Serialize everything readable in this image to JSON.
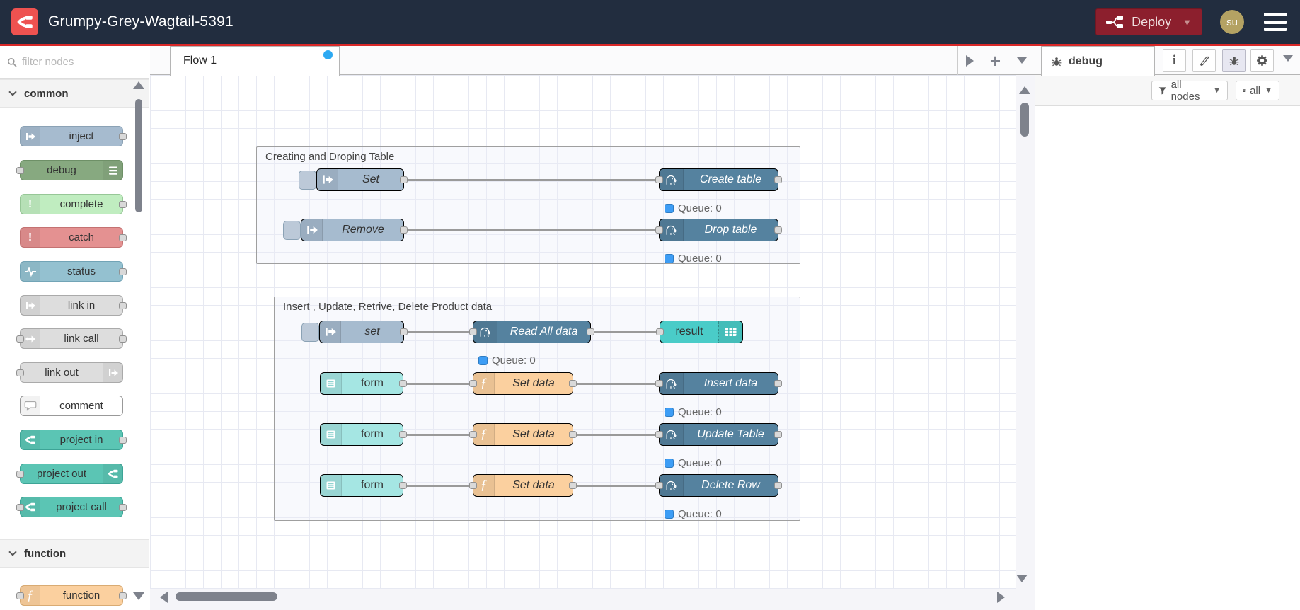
{
  "colors": {
    "header_bg": "#222d3f",
    "header_accent_red": "#d92828",
    "logo_red": "#ee5250",
    "deploy_bg": "#8c1f2d",
    "avatar_bg": "#b4a263",
    "status_dot_blue": "#3d9df5",
    "tab_dirty_dot_blue": "#2da9f2",
    "node_inject": "#a6bbcf",
    "node_debug": "#87a980",
    "node_complete": "#c0edc0",
    "node_catch": "#e49191",
    "node_status": "#94c1d0",
    "node_link": "#dddddd",
    "node_comment": "#ffffff",
    "node_project": "#5bc5b4",
    "node_function": "#fbd09f",
    "node_postgres": "#55829f",
    "node_form": "#a5e6e3",
    "node_result": "#4accc8"
  },
  "header": {
    "title": "Grumpy-Grey-Wagtail-5391",
    "deploy_label": "Deploy",
    "avatar_initials": "su"
  },
  "palette": {
    "search_placeholder": "filter nodes",
    "categories": [
      {
        "label": "common",
        "nodes": [
          {
            "label": "inject"
          },
          {
            "label": "debug"
          },
          {
            "label": "complete"
          },
          {
            "label": "catch"
          },
          {
            "label": "status"
          },
          {
            "label": "link in"
          },
          {
            "label": "link call"
          },
          {
            "label": "link out"
          },
          {
            "label": "comment"
          },
          {
            "label": "project in"
          },
          {
            "label": "project out"
          },
          {
            "label": "project call"
          }
        ]
      },
      {
        "label": "function",
        "nodes": [
          {
            "label": "function"
          }
        ]
      }
    ]
  },
  "workspace": {
    "tab_label": "Flow 1",
    "status_label": "Queue: 0",
    "groups": [
      {
        "title": "Creating and Droping Table"
      },
      {
        "title": "Insert , Update, Retrive, Delete Product data"
      }
    ],
    "nodes": {
      "set_inject": "Set",
      "create_table": "Create table",
      "remove_inject": "Remove",
      "drop_table": "Drop table",
      "set_lower_inject": "set",
      "read_all": "Read All data",
      "result": "result",
      "form": "form",
      "set_data": "Set data",
      "insert_data": "Insert data",
      "update_table": "Update Table",
      "delete_row": "Delete Row"
    }
  },
  "sidebar": {
    "tab_label": "debug",
    "filter_button": "all nodes",
    "clear_button": "all"
  }
}
